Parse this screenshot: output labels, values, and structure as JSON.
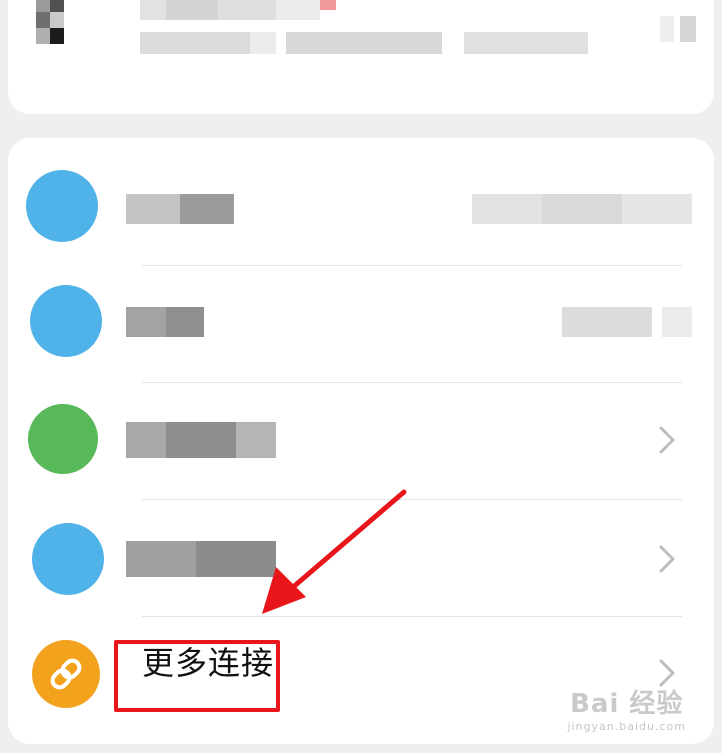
{
  "more_connections": {
    "label": "更多连接"
  },
  "watermark": {
    "brand": "Bai 经验",
    "url": "jingyan.baidu.com"
  },
  "colors": {
    "accent_orange": "#f3a21e",
    "annotation_red": "#e8161b",
    "icon_blue": "#4fb2e8",
    "icon_green": "#58b95b"
  },
  "icons": {
    "more_connections": "link-icon",
    "row_arrow": "chevron-right-icon"
  }
}
